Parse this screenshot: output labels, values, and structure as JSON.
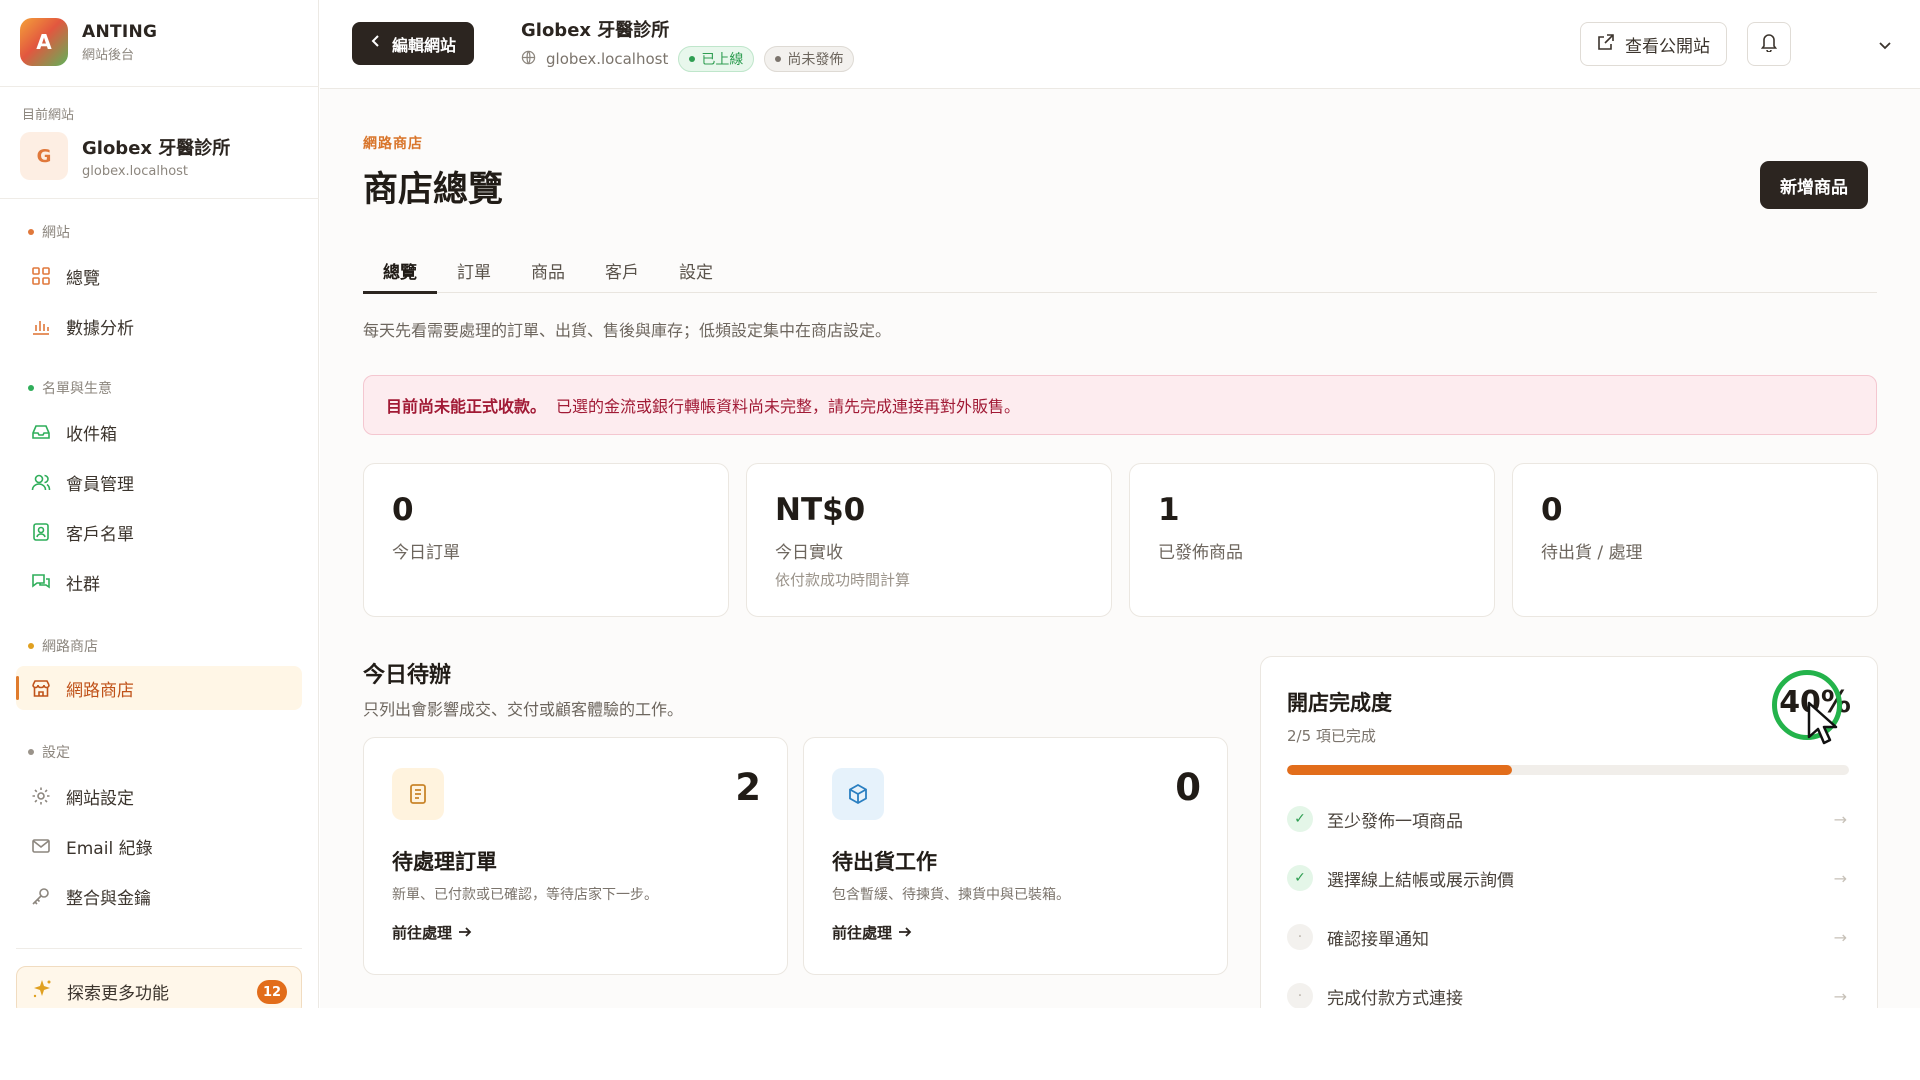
{
  "brand": {
    "logo_letter": "A",
    "name": "ANTING",
    "subtitle": "網站後台"
  },
  "current_site": {
    "label": "目前網站",
    "badge_letter": "G",
    "name": "Globex 牙醫診所",
    "domain": "globex.localhost"
  },
  "sidebar": {
    "sections": [
      {
        "label": "網站",
        "dot_color": "#e0783b"
      },
      {
        "label": "名單與生意",
        "dot_color": "#2fae5a"
      },
      {
        "label": "網路商店",
        "dot_color": "#e0a020"
      },
      {
        "label": "設定",
        "dot_color": "#9a938a"
      }
    ],
    "items": [
      {
        "label": "總覽",
        "icon": "grid-icon"
      },
      {
        "label": "數據分析",
        "icon": "bar-chart-icon"
      },
      {
        "label": "收件箱",
        "icon": "inbox-icon"
      },
      {
        "label": "會員管理",
        "icon": "users-icon"
      },
      {
        "label": "客戶名單",
        "icon": "contacts-icon"
      },
      {
        "label": "社群",
        "icon": "chat-icon"
      },
      {
        "label": "網路商店",
        "icon": "store-icon",
        "active": true
      },
      {
        "label": "網站設定",
        "icon": "gear-icon"
      },
      {
        "label": "Email 紀錄",
        "icon": "mail-icon"
      },
      {
        "label": "整合與金鑰",
        "icon": "key-icon"
      }
    ],
    "explore": {
      "label": "探索更多功能",
      "count": "12",
      "icon": "sparkle-icon"
    }
  },
  "topbar": {
    "edit_label": "編輯網站",
    "site_title": "Globex 牙醫診所",
    "domain": "globex.localhost",
    "status_live": "已上線",
    "status_draft": "尚未發佈",
    "view_public_label": "查看公開站"
  },
  "main": {
    "eyebrow": "網路商店",
    "title": "商店總覽",
    "add_product_label": "新增商品",
    "tabs": [
      "總覽",
      "訂單",
      "商品",
      "客戶",
      "設定"
    ],
    "intro": "每天先看需要處理的訂單、出貨、售後與庫存；低頻設定集中在商店設定。",
    "alert_strong": "目前尚未能正式收款。",
    "alert_text": "已選的金流或銀行轉帳資料尚未完整，請先完成連接再對外販售。",
    "stats": [
      {
        "value": "0",
        "label": "今日訂單",
        "sub": ""
      },
      {
        "value": "NT$0",
        "label": "今日實收",
        "sub": "依付款成功時間計算"
      },
      {
        "value": "1",
        "label": "已發佈商品",
        "sub": ""
      },
      {
        "value": "0",
        "label": "待出貨 / 處理",
        "sub": ""
      }
    ],
    "todo": {
      "title": "今日待辦",
      "subtitle": "只列出會影響成交、交付或顧客體驗的工作。",
      "tasks": [
        {
          "count": "2",
          "name": "待處理訂單",
          "desc": "新單、已付款或已確認，等待店家下一步。",
          "link": "前往處理",
          "icon": "receipt-icon"
        },
        {
          "count": "0",
          "name": "待出貨工作",
          "desc": "包含暫緩、待揀貨、揀貨中與已裝箱。",
          "link": "前往處理",
          "icon": "box-icon"
        }
      ]
    },
    "progress": {
      "title": "開店完成度",
      "subtitle": "2/5 項已完成",
      "percent_label": "40%",
      "fraction": 0.4,
      "items": [
        {
          "label": "至少發佈一項商品",
          "done": true
        },
        {
          "label": "選擇線上結帳或展示詢價",
          "done": true
        },
        {
          "label": "確認接單通知",
          "done": false
        },
        {
          "label": "完成付款方式連接",
          "done": false
        }
      ]
    }
  },
  "colors": {
    "accent": "#e26d1b",
    "dark": "#2c2520",
    "success": "#2f9e52",
    "danger": "#a11a35"
  }
}
